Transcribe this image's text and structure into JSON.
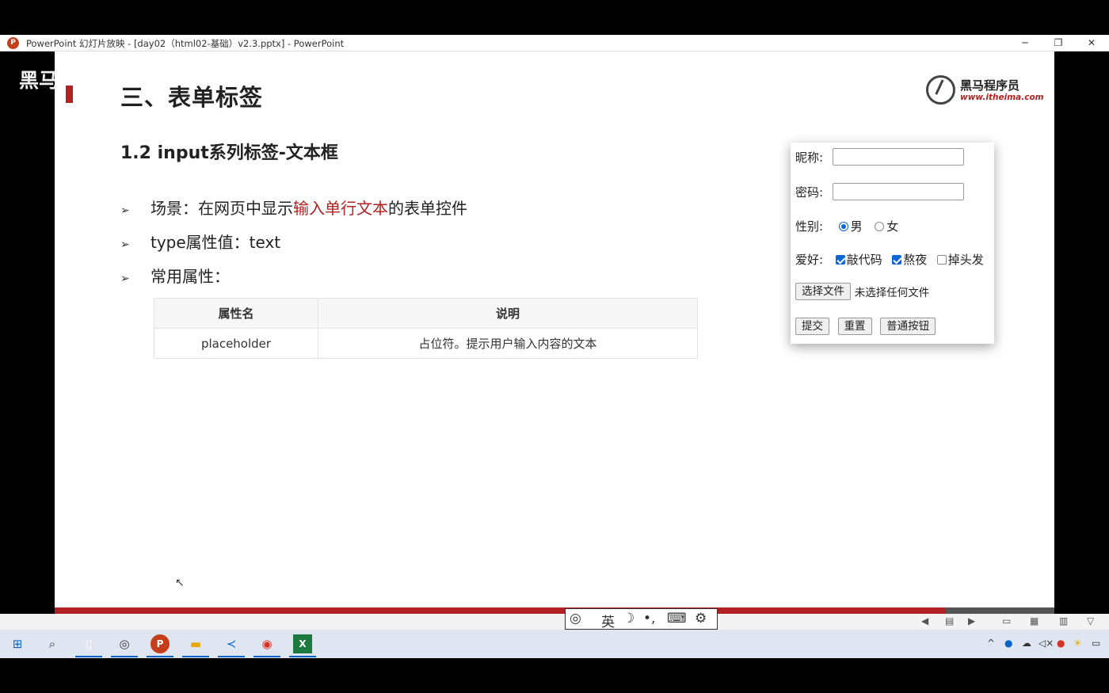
{
  "window": {
    "title": "PowerPoint 幻灯片放映 - [day02（html02-基础）v2.3.pptx] - PowerPoint",
    "app_icon": "P",
    "controls": [
      "─",
      "❐",
      "✕"
    ]
  },
  "watermark": "黑马",
  "slide": {
    "heading": "三、表单标签",
    "logo": {
      "brand": "黑马程序员",
      "url": "www.itheima.com"
    },
    "subheading": "1.2 input系列标签-文本框",
    "bullets": [
      {
        "before": "场景：在网页中显示",
        "highlight": "输入单行文本",
        "after": "的表单控件"
      },
      {
        "text": "type属性值：text"
      },
      {
        "text": "常用属性："
      }
    ],
    "bullet_marker": "➢",
    "table": {
      "headers": [
        "属性名",
        "说明"
      ],
      "rows": [
        [
          "placeholder",
          "占位符。提示用户输入内容的文本"
        ]
      ]
    },
    "form_demo": {
      "nickname_label": "昵称:",
      "password_label": "密码:",
      "gender_label": "性别:",
      "gender_options": [
        "男",
        "女"
      ],
      "gender_selected": "男",
      "hobby_label": "爱好:",
      "hobbies": [
        {
          "label": "敲代码",
          "checked": true
        },
        {
          "label": "熬夜",
          "checked": true
        },
        {
          "label": "掉头发",
          "checked": false
        }
      ],
      "file_button": "选择文件",
      "file_status": "未选择任何文件",
      "buttons": [
        "提交",
        "重置",
        "普通按钮"
      ]
    }
  },
  "ime": {
    "mode": "英"
  },
  "taskbar": {
    "apps": [
      "start-icon",
      "search-icon",
      "file-icon",
      "browser-icon",
      "powerpoint-icon",
      "explorer-icon",
      "vscode-icon",
      "chrome-icon",
      "excel-icon"
    ]
  },
  "colors": {
    "accent_red": "#b22222",
    "checkbox_blue": "#0b66d6",
    "taskbar": "#dfe6f2"
  }
}
